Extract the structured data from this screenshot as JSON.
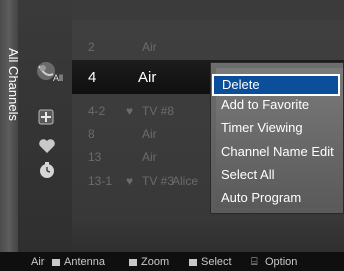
{
  "screen": {
    "title": "All Channels"
  },
  "sidebar": {
    "icons": [
      {
        "name": "satellite-dish-icon",
        "label": "All"
      },
      {
        "name": "add-channel-icon"
      },
      {
        "name": "heart-icon"
      },
      {
        "name": "timer-icon"
      }
    ]
  },
  "channels": [
    {
      "num": "2",
      "name": "Air",
      "favorite": false,
      "selected": false
    },
    {
      "num": "4",
      "name": "Air",
      "favorite": false,
      "selected": true
    },
    {
      "num": "4-2",
      "name": "TV #8",
      "favorite": true,
      "selected": false
    },
    {
      "num": "8",
      "name": "Air",
      "favorite": false,
      "selected": false
    },
    {
      "num": "13",
      "name": "Air",
      "favorite": false,
      "selected": false
    },
    {
      "num": "13-1",
      "name": "TV #3",
      "favorite": true,
      "selected": false,
      "extra": "Alice"
    }
  ],
  "option_menu": {
    "items": [
      "Delete",
      "Add to Favorite",
      "Timer Viewing",
      "Channel Name Edit",
      "Select All",
      "Auto Program"
    ],
    "highlighted_index": 0
  },
  "bottom_bar": {
    "source": "Air",
    "antenna_label": "Antenna",
    "zoom_label": "Zoom",
    "select_label": "Select",
    "option_label": "Option"
  },
  "colors": {
    "highlight": "#0b4f9a"
  }
}
